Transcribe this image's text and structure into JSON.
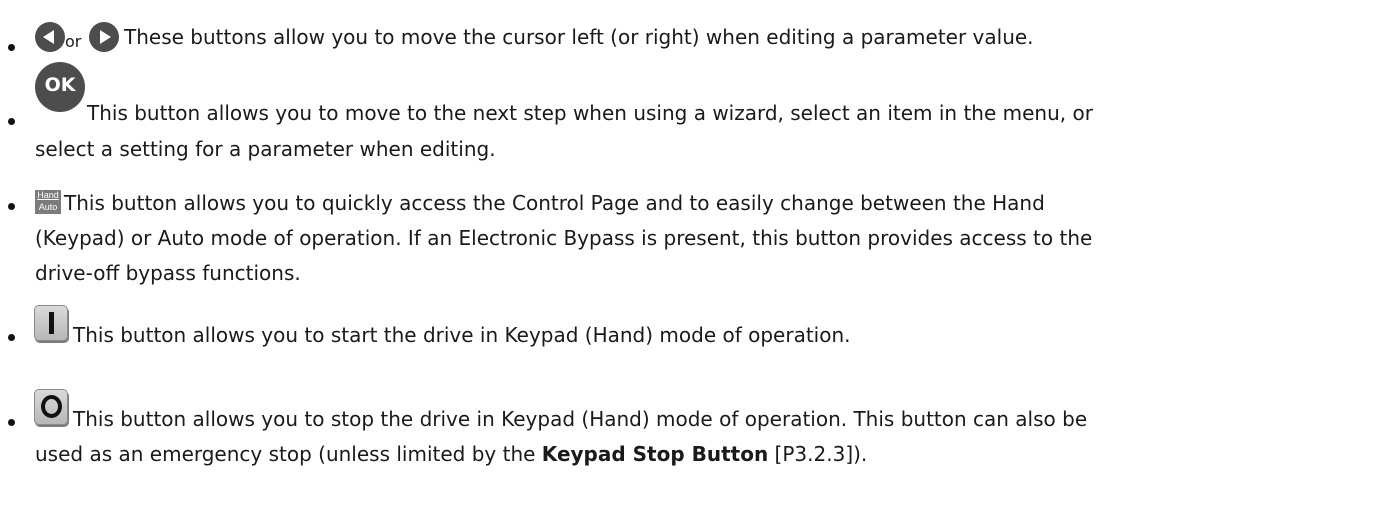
{
  "bullets": [
    {
      "connector": "or",
      "lines": [
        "These buttons allow you to move the cursor left (or right) when editing a parameter value."
      ],
      "icons": [
        "arrow-left-button-icon",
        "arrow-right-button-icon"
      ]
    },
    {
      "icon_label": "OK",
      "lines": [
        "This button allows you to move to the next step when using a wizard, select an item in the menu, or",
        "select a setting for a parameter when editing."
      ],
      "icons": [
        "ok-button-icon"
      ]
    },
    {
      "icon_label_top": "Hand",
      "icon_label_bottom": "Auto",
      "lines": [
        "This button allows you to quickly access the Control Page and to easily change between the Hand",
        "(Keypad) or Auto mode of operation. If an Electronic Bypass is present, this button provides access to the",
        "drive-off bypass functions."
      ],
      "icons": [
        "hand-auto-button-icon"
      ]
    },
    {
      "lines": [
        "This button allows you to start the drive in Keypad (Hand) mode of operation."
      ],
      "icons": [
        "start-button-icon"
      ]
    },
    {
      "line1": "This button allows you to stop the drive in Keypad (Hand) mode of operation. This button can also be",
      "line2_pre": "used as an emergency stop (unless limited by the ",
      "line2_bold": "Keypad Stop Button",
      "line2_post": " [P3.2.3]).",
      "icons": [
        "stop-button-icon"
      ]
    }
  ],
  "colors": {
    "text": "#1a1a1a",
    "icon_dark": "#4d4d4d",
    "key_grey": "#c9c9c9",
    "hand_auto_bg": "#7b7b7b"
  }
}
